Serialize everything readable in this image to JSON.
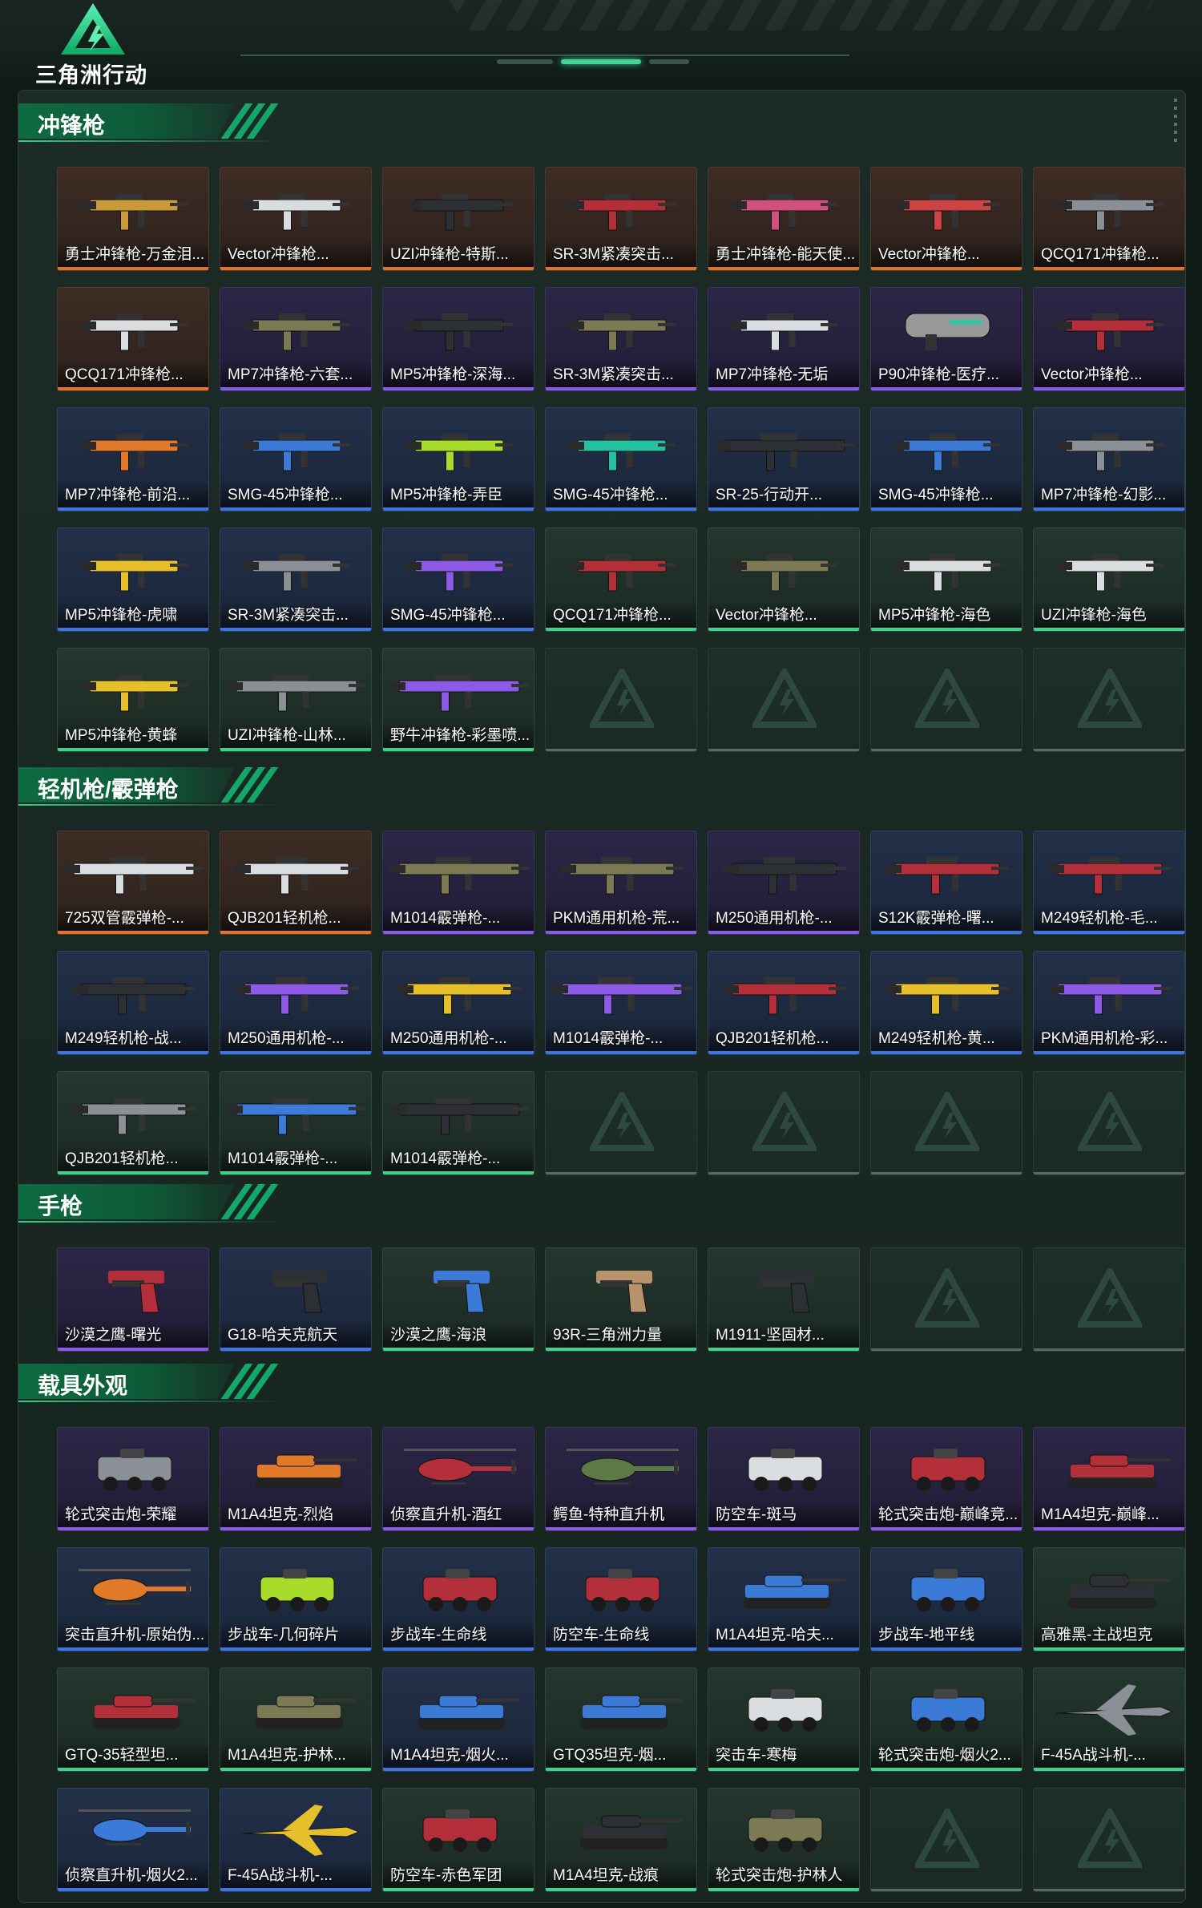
{
  "app": {
    "logo_text": "三角洲行动"
  },
  "sections": [
    {
      "title": "冲锋枪",
      "items": [
        {
          "label": "勇士冲锋枪-万金泪...",
          "rarity": "orange",
          "icon": "smg-gold"
        },
        {
          "label": "Vector冲锋枪...",
          "rarity": "orange",
          "icon": "smg-white"
        },
        {
          "label": "UZI冲锋枪-特斯...",
          "rarity": "orange",
          "icon": "smg-dark"
        },
        {
          "label": "SR-3M紧凑突击...",
          "rarity": "orange",
          "icon": "smg-red"
        },
        {
          "label": "勇士冲锋枪-能天使...",
          "rarity": "orange",
          "icon": "smg-pink"
        },
        {
          "label": "Vector冲锋枪...",
          "rarity": "orange",
          "icon": "smg-redwhite"
        },
        {
          "label": "QCQ171冲锋枪...",
          "rarity": "orange",
          "icon": "smg-grey"
        },
        {
          "label": "QCQ171冲锋枪...",
          "rarity": "orange",
          "icon": "smg-white"
        },
        {
          "label": "MP7冲锋枪-六套...",
          "rarity": "purple",
          "icon": "smg-camo"
        },
        {
          "label": "MP5冲锋枪-深海...",
          "rarity": "purple",
          "icon": "smg-dark"
        },
        {
          "label": "SR-3M紧凑突击...",
          "rarity": "purple",
          "icon": "smg-camo"
        },
        {
          "label": "MP7冲锋枪-无垢",
          "rarity": "purple",
          "icon": "smg-white"
        },
        {
          "label": "P90冲锋枪-医疗...",
          "rarity": "purple",
          "icon": "p90"
        },
        {
          "label": "Vector冲锋枪...",
          "rarity": "purple",
          "icon": "smg-red"
        },
        {
          "label": "MP7冲锋枪-前沿...",
          "rarity": "blue",
          "icon": "smg-orange"
        },
        {
          "label": "SMG-45冲锋枪...",
          "rarity": "blue",
          "icon": "smg-blue"
        },
        {
          "label": "MP5冲锋枪-弄臣",
          "rarity": "blue",
          "icon": "smg-lime"
        },
        {
          "label": "SMG-45冲锋枪...",
          "rarity": "blue",
          "icon": "smg-teal"
        },
        {
          "label": "SR-25-行动开...",
          "rarity": "blue",
          "icon": "rifle-dark"
        },
        {
          "label": "SMG-45冲锋枪...",
          "rarity": "blue",
          "icon": "smg-blue"
        },
        {
          "label": "MP7冲锋枪-幻影...",
          "rarity": "blue",
          "icon": "smg-grey"
        },
        {
          "label": "MP5冲锋枪-虎啸",
          "rarity": "blue",
          "icon": "smg-yellow"
        },
        {
          "label": "SR-3M紧凑突击...",
          "rarity": "blue",
          "icon": "smg-grey"
        },
        {
          "label": "SMG-45冲锋枪...",
          "rarity": "blue",
          "icon": "smg-violet"
        },
        {
          "label": "QCQ171冲锋枪...",
          "rarity": "green",
          "icon": "smg-red"
        },
        {
          "label": "Vector冲锋枪...",
          "rarity": "green",
          "icon": "smg-camo"
        },
        {
          "label": "MP5冲锋枪-海色",
          "rarity": "green",
          "icon": "smg-white"
        },
        {
          "label": "UZI冲锋枪-海色",
          "rarity": "green",
          "icon": "smg-white"
        },
        {
          "label": "MP5冲锋枪-黄蜂",
          "rarity": "green",
          "icon": "smg-yellow"
        },
        {
          "label": "UZI冲锋枪-山林...",
          "rarity": "green",
          "icon": "rifle-grey"
        },
        {
          "label": "野牛冲锋枪-彩墨喷...",
          "rarity": "green",
          "icon": "rifle-violet"
        }
      ],
      "empty": 4
    },
    {
      "title": "轻机枪/霰弹枪",
      "items": [
        {
          "label": "725双管霰弹枪-...",
          "rarity": "orange",
          "icon": "shotgun-white"
        },
        {
          "label": "QJB201轻机枪...",
          "rarity": "orange",
          "icon": "lmg-white"
        },
        {
          "label": "M1014霰弹枪-...",
          "rarity": "purple",
          "icon": "rifle-camo"
        },
        {
          "label": "PKM通用机枪-荒...",
          "rarity": "purple",
          "icon": "lmg-camo"
        },
        {
          "label": "M250通用机枪-...",
          "rarity": "purple",
          "icon": "lmg-dark"
        },
        {
          "label": "S12K霰弹枪-曙...",
          "rarity": "blue",
          "icon": "lmg-red"
        },
        {
          "label": "M249轻机枪-毛...",
          "rarity": "blue",
          "icon": "lmg-red"
        },
        {
          "label": "M249轻机枪-战...",
          "rarity": "blue",
          "icon": "lmg-dark"
        },
        {
          "label": "M250通用机枪-...",
          "rarity": "blue",
          "icon": "lmg-violet"
        },
        {
          "label": "M250通用机枪-...",
          "rarity": "blue",
          "icon": "lmg-yellow"
        },
        {
          "label": "M1014霰弹枪-...",
          "rarity": "blue",
          "icon": "shotgun-violet"
        },
        {
          "label": "QJB201轻机枪...",
          "rarity": "blue",
          "icon": "lmg-red"
        },
        {
          "label": "M249轻机枪-黄...",
          "rarity": "blue",
          "icon": "lmg-yellow"
        },
        {
          "label": "PKM通用机枪-彩...",
          "rarity": "blue",
          "icon": "lmg-violet"
        },
        {
          "label": "QJB201轻机枪...",
          "rarity": "green",
          "icon": "lmg-grey"
        },
        {
          "label": "M1014霰弹枪-...",
          "rarity": "green",
          "icon": "shotgun-blue"
        },
        {
          "label": "M1014霰弹枪-...",
          "rarity": "green",
          "icon": "shotgun-dark"
        }
      ],
      "empty": 4
    },
    {
      "title": "手枪",
      "items": [
        {
          "label": "沙漠之鹰-曙光",
          "rarity": "purple",
          "icon": "pistol-red"
        },
        {
          "label": "G18-哈夫克航天",
          "rarity": "blue",
          "icon": "pistol-dark"
        },
        {
          "label": "沙漠之鹰-海浪",
          "rarity": "green",
          "icon": "pistol-blue"
        },
        {
          "label": "93R-三角洲力量",
          "rarity": "green",
          "icon": "pistol-tan"
        },
        {
          "label": "M1911-坚固材...",
          "rarity": "green",
          "icon": "pistol-dark"
        }
      ],
      "empty": 2
    },
    {
      "title": "载具外观",
      "items": [
        {
          "label": "轮式突击炮-荣耀",
          "rarity": "purple",
          "icon": "vehicle-grey"
        },
        {
          "label": "M1A4坦克-烈焰",
          "rarity": "purple",
          "icon": "tank-orange"
        },
        {
          "label": "侦察直升机-酒红",
          "rarity": "purple",
          "icon": "heli-red"
        },
        {
          "label": "鳄鱼-特种直升机",
          "rarity": "purple",
          "icon": "heli-green"
        },
        {
          "label": "防空车-斑马",
          "rarity": "purple",
          "icon": "apc-white"
        },
        {
          "label": "轮式突击炮-巅峰竞...",
          "rarity": "purple",
          "icon": "vehicle-red"
        },
        {
          "label": "M1A4坦克-巅峰...",
          "rarity": "purple",
          "icon": "tank-red"
        },
        {
          "label": "突击直升机-原始伪...",
          "rarity": "blue",
          "icon": "heli-orange"
        },
        {
          "label": "步战车-几何碎片",
          "rarity": "blue",
          "icon": "apc-lime"
        },
        {
          "label": "步战车-生命线",
          "rarity": "blue",
          "icon": "apc-red"
        },
        {
          "label": "防空车-生命线",
          "rarity": "blue",
          "icon": "apc-red"
        },
        {
          "label": "M1A4坦克-哈夫...",
          "rarity": "blue",
          "icon": "tank-blue"
        },
        {
          "label": "步战车-地平线",
          "rarity": "blue",
          "icon": "apc-blue"
        },
        {
          "label": "高雅黑-主战坦克",
          "rarity": "green",
          "icon": "tank-dark"
        },
        {
          "label": "GTQ-35轻型坦...",
          "rarity": "green",
          "icon": "tank-red"
        },
        {
          "label": "M1A4坦克-护林...",
          "rarity": "green",
          "icon": "tank-camo"
        },
        {
          "label": "M1A4坦克-烟火...",
          "rarity": "blue",
          "icon": "tank-blue"
        },
        {
          "label": "GTQ35坦克-烟...",
          "rarity": "green",
          "icon": "tank-blue"
        },
        {
          "label": "突击车-寒梅",
          "rarity": "green",
          "icon": "vehicle-white"
        },
        {
          "label": "轮式突击炮-烟火2...",
          "rarity": "green",
          "icon": "vehicle-blue"
        },
        {
          "label": "F-45A战斗机-...",
          "rarity": "green",
          "icon": "jet-grey"
        },
        {
          "label": "侦察直升机-烟火2...",
          "rarity": "blue",
          "icon": "heli-blue"
        },
        {
          "label": "F-45A战斗机-...",
          "rarity": "blue",
          "icon": "jet-yellow"
        },
        {
          "label": "防空车-赤色军团",
          "rarity": "green",
          "icon": "apc-red"
        },
        {
          "label": "M1A4坦克-战痕",
          "rarity": "green",
          "icon": "tank-dark"
        },
        {
          "label": "轮式突击炮-护林人",
          "rarity": "green",
          "icon": "vehicle-camo"
        }
      ],
      "empty": 2
    }
  ]
}
